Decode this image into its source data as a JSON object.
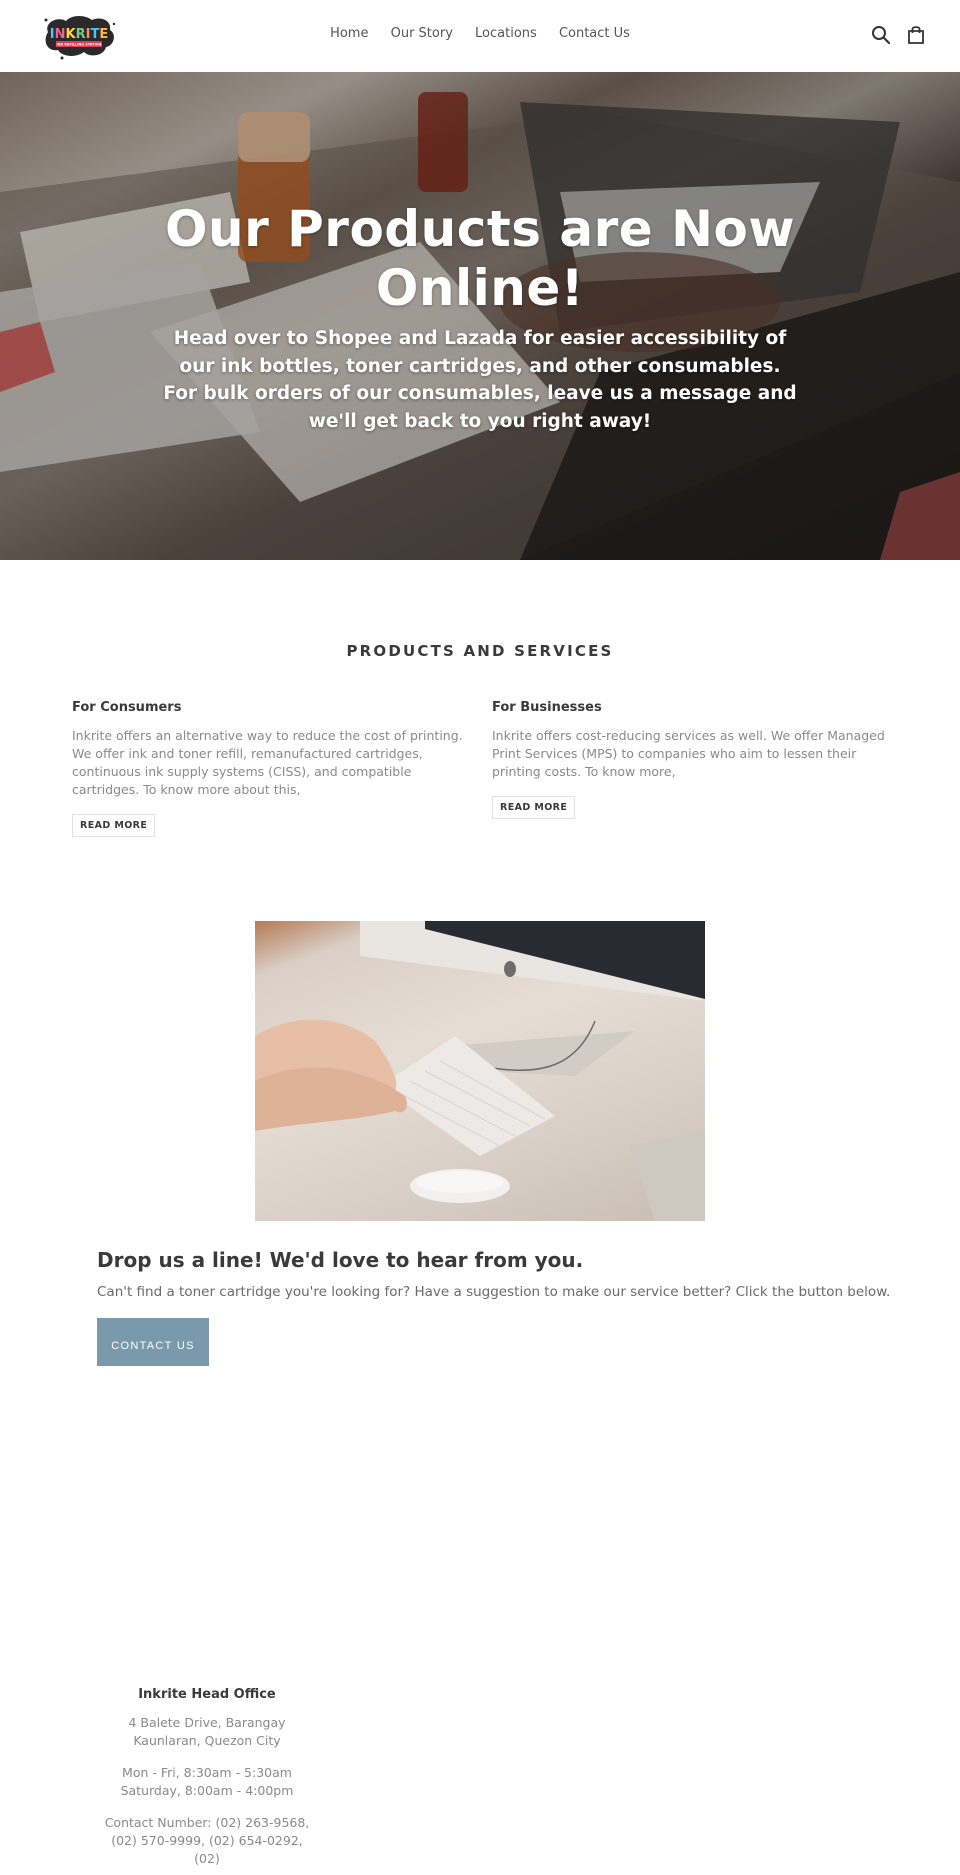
{
  "header": {
    "logo_text": "INKRITE",
    "logo_tagline": "INK REFILLING STATION",
    "nav": [
      {
        "label": "Home"
      },
      {
        "label": "Our Story"
      },
      {
        "label": "Locations"
      },
      {
        "label": "Contact Us"
      }
    ],
    "icons": {
      "search": "search-icon",
      "cart": "shopping-bag-icon"
    }
  },
  "hero": {
    "title": "Our Products are Now Online!",
    "subtitle": "Head over to Shopee and Lazada for easier accessibility of our ink bottles, toner cartridges, and other consumables. For bulk orders of our consumables, leave us a message and we'll get back to you right away!"
  },
  "products": {
    "section_title": "PRODUCTS AND SERVICES",
    "columns": [
      {
        "heading": "For Consumers",
        "text": "Inkrite offers an alternative way to reduce the cost of printing. We offer ink and toner refill, remanufactured cartridges, continuous ink supply systems (CISS), and compatible cartridges. To know more about this,",
        "button": "READ MORE"
      },
      {
        "heading": "For Businesses",
        "text": "Inkrite offers cost-reducing services as well. We offer Managed Print Services (MPS) to companies who aim to lessen their printing costs. To know more,",
        "button": "READ MORE"
      }
    ]
  },
  "contact": {
    "title": "Drop us a line! We'd love to hear from you.",
    "text": "Can't find a toner cartridge you're looking for? Have a suggestion to make our service better? Click the button below.",
    "button": "CONTACT US"
  },
  "footer": {
    "office_title": "Inkrite Head Office",
    "address": "4 Balete Drive, Barangay Kaunlaran, Quezon City",
    "hours_weekday": "Mon - Fri, 8:30am - 5:30am",
    "hours_saturday": "Saturday, 8:00am - 4:00pm",
    "contact_numbers": "Contact Number: (02) 263-9568, (02) 570-9999, (02) 654-0292, (02)"
  },
  "colors": {
    "contact_button": "#7a99aa",
    "text_dark": "#3a3a3a",
    "text_muted": "#8a8a8a"
  }
}
